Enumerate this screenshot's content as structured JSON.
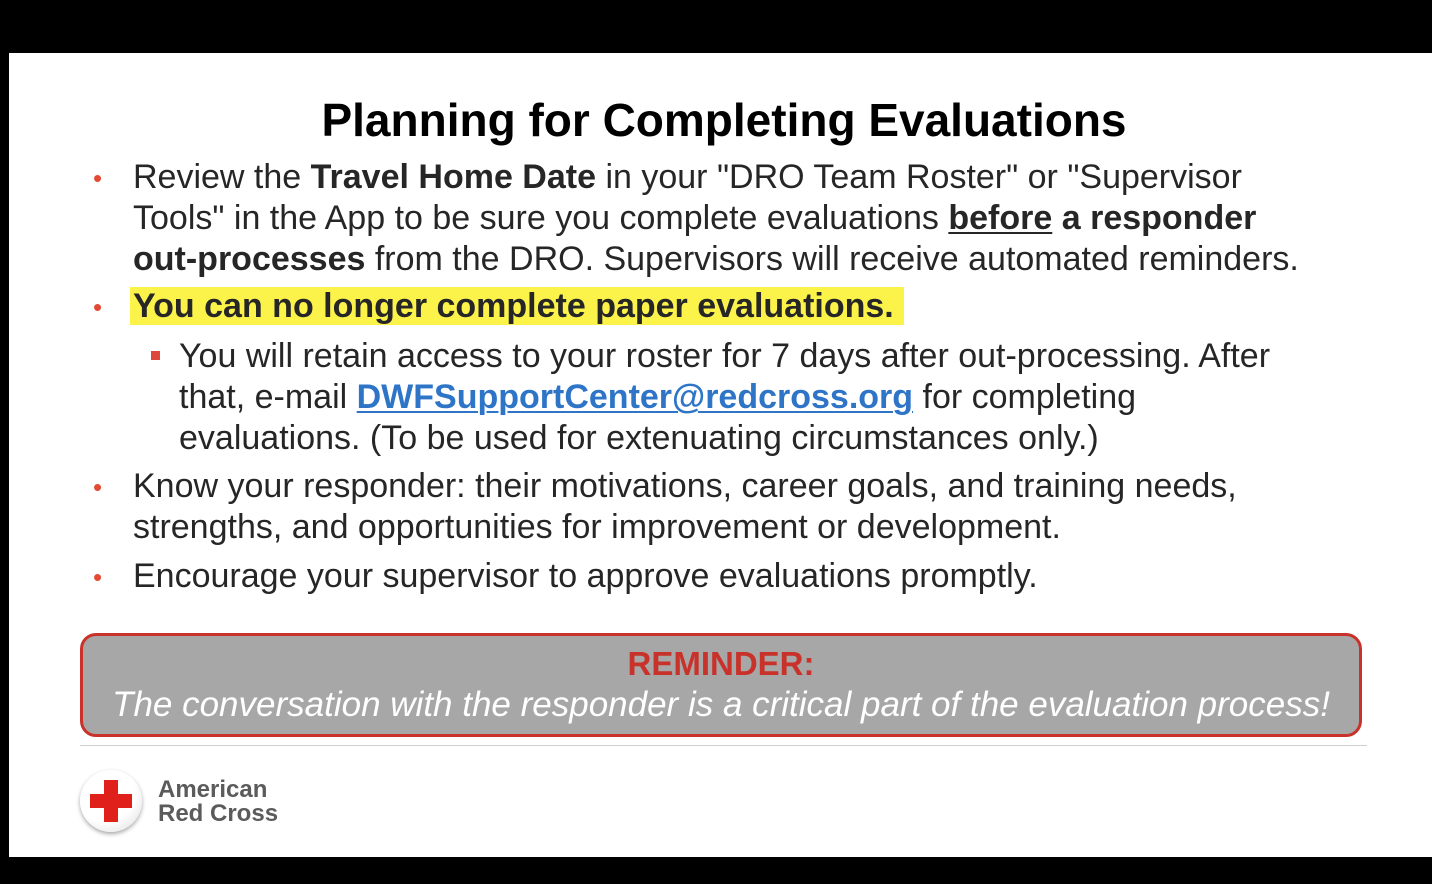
{
  "slide": {
    "title": "Planning for Completing Evaluations",
    "bullet_glyph": "•",
    "bullets": [
      {
        "parts": [
          "Review the ",
          "Travel Home Date",
          " in your \"DRO Team Roster\" or \"Supervisor",
          "Tools\" in the App to be sure you complete evaluations ",
          "before",
          " a responder",
          "out-processes",
          " from the DRO. Supervisors will receive automated reminders."
        ]
      },
      {
        "highlight": "You can no longer complete paper evaluations."
      },
      {
        "sub": [
          "You will retain access to your roster for 7 days after out-processing.  After",
          "that, e-mail ",
          "DWFSupportCenter@redcross.org",
          " for completing",
          "evaluations. (To be used for extenuating circumstances only.)"
        ]
      },
      {
        "parts": [
          "Know your responder: their motivations, career goals, and training needs,",
          "strengths, and opportunities for improvement or development."
        ]
      },
      {
        "parts": [
          "Encourage your supervisor to approve evaluations promptly."
        ]
      }
    ],
    "reminder": {
      "title": "REMINDER:",
      "text": "The conversation with the responder is a critical part of the evaluation process!"
    },
    "logo": {
      "line1": "American",
      "line2": "Red Cross",
      "icon": "red-cross-icon"
    },
    "colors": {
      "bullet": "#e34a33",
      "highlight": "#fbf24a",
      "link": "#2e75c8",
      "reminder_border": "#c8322a",
      "reminder_bg": "#a7a7a7"
    }
  }
}
